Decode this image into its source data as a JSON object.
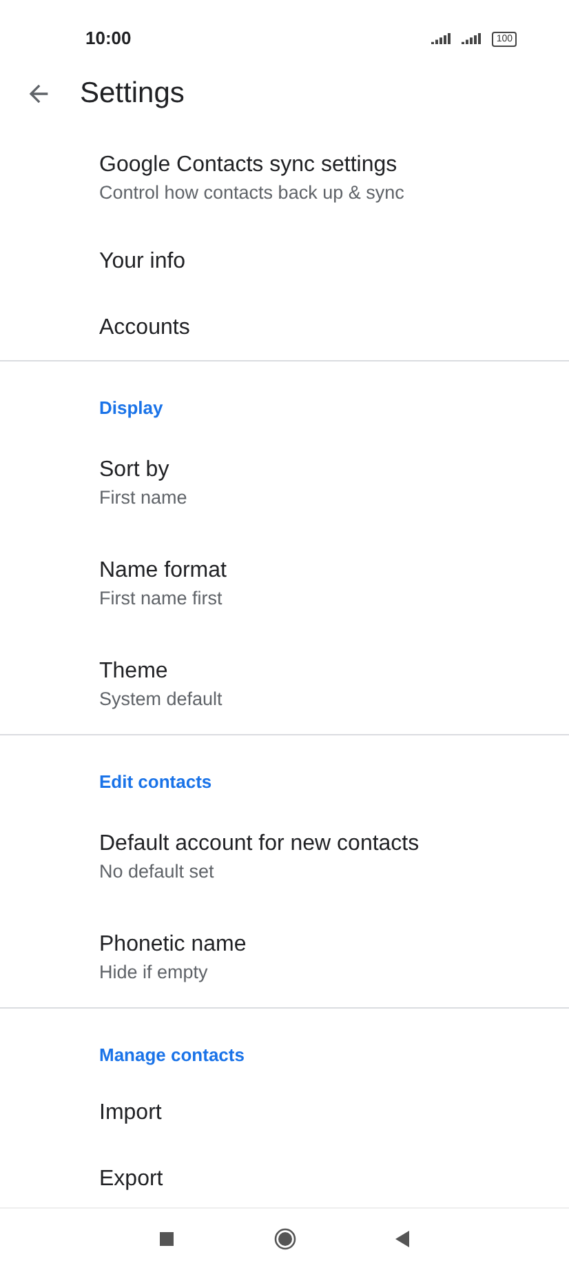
{
  "status_bar": {
    "time": "10:00",
    "battery": "100"
  },
  "toolbar": {
    "title": "Settings"
  },
  "sections": [
    {
      "items": [
        {
          "title": "Google Contacts sync settings",
          "subtitle": "Control how contacts back up & sync"
        },
        {
          "title": "Your info"
        },
        {
          "title": "Accounts"
        }
      ]
    },
    {
      "header": "Display",
      "items": [
        {
          "title": "Sort by",
          "subtitle": "First name"
        },
        {
          "title": "Name format",
          "subtitle": "First name first"
        },
        {
          "title": "Theme",
          "subtitle": "System default"
        }
      ]
    },
    {
      "header": "Edit contacts",
      "items": [
        {
          "title": "Default account for new contacts",
          "subtitle": "No default set"
        },
        {
          "title": "Phonetic name",
          "subtitle": "Hide if empty"
        }
      ]
    },
    {
      "header": "Manage contacts",
      "items": [
        {
          "title": "Import"
        },
        {
          "title": "Export"
        }
      ]
    }
  ]
}
